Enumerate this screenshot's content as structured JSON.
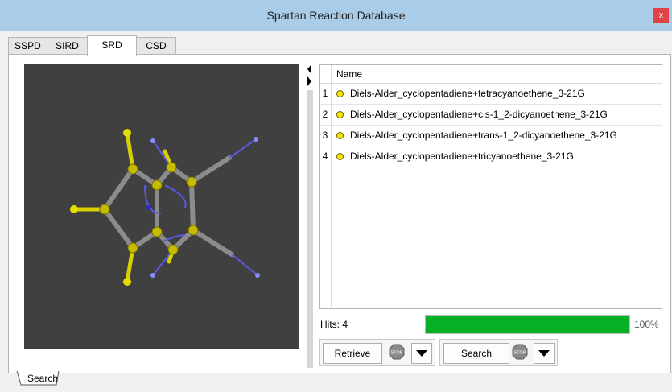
{
  "window": {
    "title": "Spartan Reaction Database",
    "close_label": "x"
  },
  "tabs": [
    {
      "label": "SSPD",
      "active": false
    },
    {
      "label": "SIRD",
      "active": false
    },
    {
      "label": "SRD",
      "active": true
    },
    {
      "label": "CSD",
      "active": false
    }
  ],
  "results": {
    "column_header": "Name",
    "rows": [
      {
        "num": "1",
        "name": "Diels-Alder_cyclopentadiene+tetracyanoethene_3-21G"
      },
      {
        "num": "2",
        "name": "Diels-Alder_cyclopentadiene+cis-1_2-dicyanoethene_3-21G"
      },
      {
        "num": "3",
        "name": "Diels-Alder_cyclopentadiene+trans-1_2-dicyanoethene_3-21G"
      },
      {
        "num": "4",
        "name": "Diels-Alder_cyclopentadiene+tricyanoethene_3-21G"
      }
    ]
  },
  "status": {
    "hits_label": "Hits: 4",
    "progress_fraction": 1.0,
    "progress_text": "100%"
  },
  "buttons": {
    "retrieve_label": "Retrieve",
    "search_label": "Search",
    "stop_text": "STOP"
  },
  "bottom_tab": {
    "label": "Search"
  },
  "colors": {
    "progress": "#06b025",
    "close": "#e04343",
    "titlebar": "#a9cde8",
    "viewer_bg": "#404040",
    "hydrogen": "#d9d000",
    "carbon": "#8c8c8c",
    "nitrogen": "#3a3ad6"
  },
  "icons": {
    "stop": "stop-sign-icon",
    "dropdown": "chevron-down-icon",
    "splitter": "triangle-arrow-icon",
    "molecule": "molecule-3d-icon"
  }
}
